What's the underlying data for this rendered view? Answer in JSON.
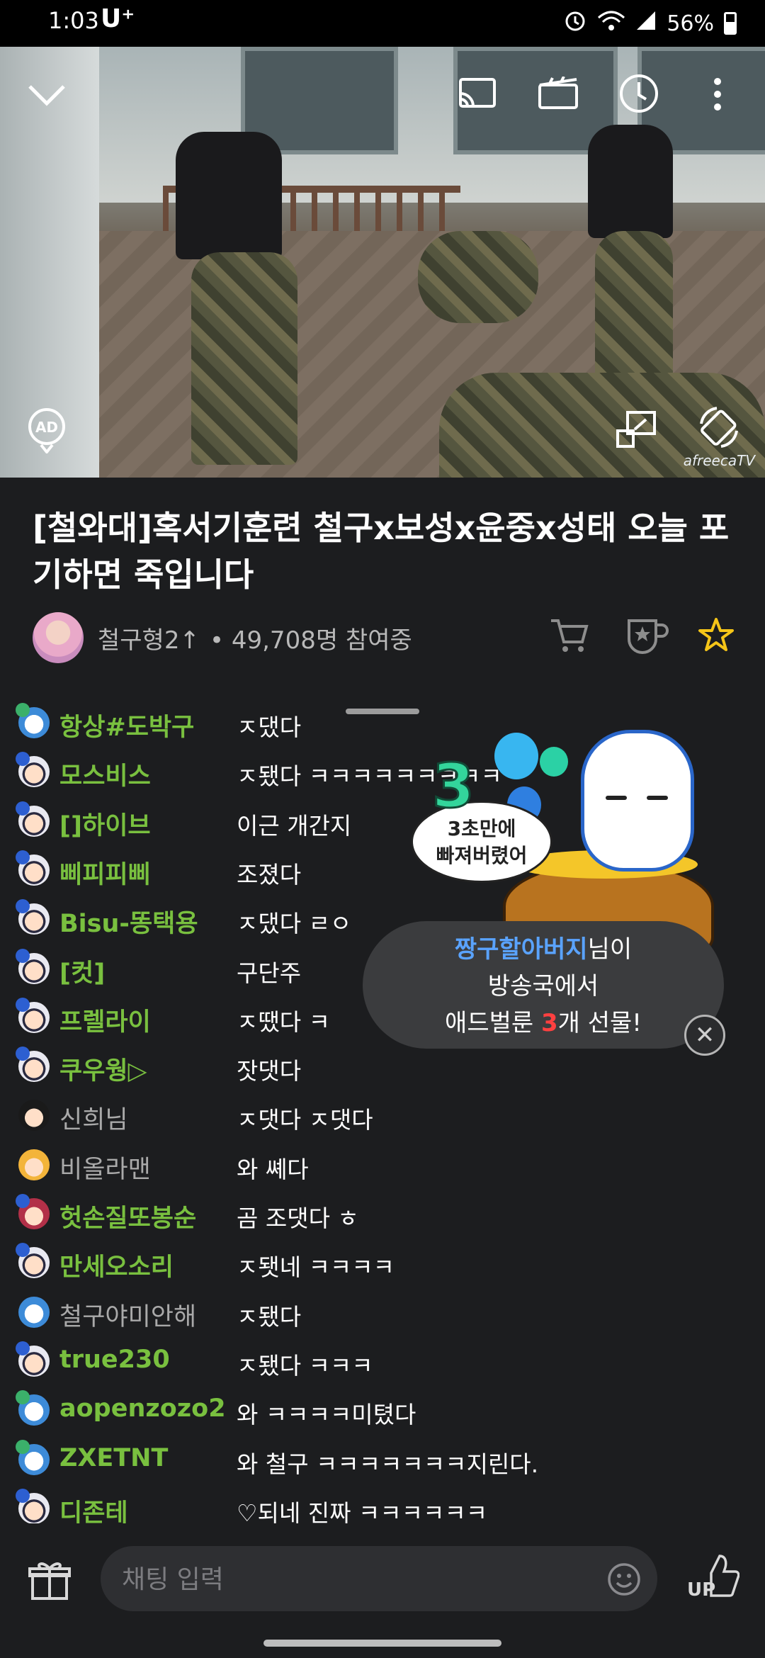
{
  "status_bar": {
    "time": "1:03",
    "carrier": "U⁺",
    "battery": "56%"
  },
  "video": {
    "watermark": "afreecaTV",
    "ad_label": "AD"
  },
  "broadcast": {
    "title": "[철와대]혹서기훈련 철구x보성x윤중x성태 오늘 포기하면 죽입니다",
    "streamer": "철구형2↑",
    "viewers": "• 49,708명 참여중"
  },
  "chat": {
    "messages": [
      {
        "name": "항상#도박구",
        "text": "ㅈ댔다",
        "badge": "blue",
        "name_style": "green"
      },
      {
        "name": "모스비스",
        "text": "ㅈ됐다 ㅋㅋㅋㅋㅋㅋㅋㅋㅋ",
        "badge": "fan",
        "name_style": "green"
      },
      {
        "name": "[]하이브",
        "text": "이근 개간지",
        "badge": "fan",
        "name_style": "green"
      },
      {
        "name": "삐피피삐",
        "text": "조졌다",
        "badge": "fan",
        "name_style": "green"
      },
      {
        "name": "Bisu-똥택용",
        "text": "ㅈ댔다 ㄹㅇ",
        "badge": "fan",
        "name_style": "green"
      },
      {
        "name": "[컷]",
        "text": "구단주",
        "badge": "fan",
        "name_style": "green"
      },
      {
        "name": "프렐라이",
        "text": "ㅈ땠다 ㅋ",
        "badge": "fan",
        "name_style": "green"
      },
      {
        "name": "쿠우웡▷",
        "text": "잣댓다",
        "badge": "fan",
        "name_style": "green"
      },
      {
        "name": "신희님",
        "text": "ㅈ댓다 ㅈ댓다",
        "badge": "plain",
        "name_style": "gray"
      },
      {
        "name": "비올라맨",
        "text": "와 쎼다",
        "badge": "yellow",
        "name_style": "gray"
      },
      {
        "name": "헛손질또봉순",
        "text": "곰 조댓다 ㅎ",
        "badge": "red",
        "name_style": "green"
      },
      {
        "name": "만세오소리",
        "text": "ㅈ됏네 ㅋㅋㅋㅋ",
        "badge": "fan",
        "name_style": "green"
      },
      {
        "name": "철구야미안해",
        "text": "ㅈ됐다",
        "badge": "blue-plain",
        "name_style": "gray"
      },
      {
        "name": "true230",
        "text": "ㅈ됐다 ㅋㅋㅋ",
        "badge": "fan",
        "name_style": "green"
      },
      {
        "name": "aopenzozo2",
        "text": "와 ㅋㅋㅋㅋ미텼다",
        "badge": "blue",
        "name_style": "green"
      },
      {
        "name": "ZXETNT",
        "text": "와 철구 ㅋㅋㅋㅋㅋㅋㅋ지린다.",
        "badge": "blue",
        "name_style": "green"
      },
      {
        "name": "디존테",
        "text": "♡되네 진짜 ㅋㅋㅋㅋㅋㅋ",
        "badge": "fan",
        "name_style": "green"
      }
    ]
  },
  "gift": {
    "sticker_count": "3",
    "sticker_text_1": "3초만에",
    "sticker_text_2": "빠져버렸어",
    "gifter": "짱구할아버지",
    "line1_suffix": "님이",
    "line2": "방송국에서",
    "line3_prefix": "애드벌룬 ",
    "count": "3",
    "line3_suffix": "개 선물!",
    "close_symbol": "✕"
  },
  "input": {
    "placeholder": "채팅 입력"
  },
  "up_label": "UP",
  "colors": {
    "name_green": "#79c03f",
    "gifter_blue": "#5aa3ff",
    "gift_count_red": "#ff4040",
    "star": "#f5c518"
  }
}
